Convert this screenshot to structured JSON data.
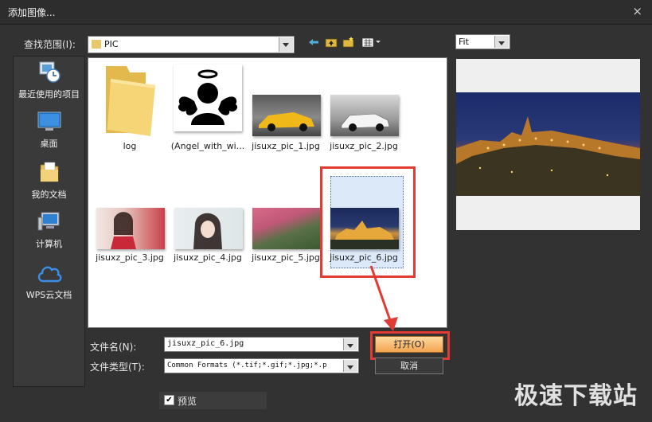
{
  "window": {
    "title": "添加图像...",
    "close_glyph": "×"
  },
  "lookin": {
    "label": "查找范围(I):",
    "value": "PIC"
  },
  "places": [
    {
      "label": "最近使用的项目",
      "icon": "recent-icon"
    },
    {
      "label": "桌面",
      "icon": "desktop-icon"
    },
    {
      "label": "我的文档",
      "icon": "documents-icon"
    },
    {
      "label": "计算机",
      "icon": "computer-icon"
    },
    {
      "label": "WPS云文档",
      "icon": "cloud-icon"
    }
  ],
  "files": [
    {
      "name": "log",
      "type": "folder"
    },
    {
      "name": "(Angel_with_wi...",
      "type": "image"
    },
    {
      "name": "jisuxz_pic_1.jpg",
      "type": "image"
    },
    {
      "name": "jisuxz_pic_2.jpg",
      "type": "image"
    },
    {
      "name": "jisuxz_pic_3.jpg",
      "type": "image"
    },
    {
      "name": "jisuxz_pic_4.jpg",
      "type": "image"
    },
    {
      "name": "jisuxz_pic_5.jpg",
      "type": "image"
    },
    {
      "name": "jisuxz_pic_6.jpg",
      "type": "image",
      "selected": true
    }
  ],
  "filename": {
    "label": "文件名(N):",
    "value": "jisuxz_pic_6.jpg"
  },
  "filetype": {
    "label": "文件类型(T):",
    "value": "Common Formats (*.tif;*.gif;*.jpg;*.p"
  },
  "buttons": {
    "open": "打开(O)",
    "cancel": "取消"
  },
  "preview": {
    "checkbox_label": "预览",
    "checked": true,
    "fit_value": "Fit"
  },
  "watermark": "极速下载站",
  "colors": {
    "highlight": "#e23b34",
    "open_button": "#f0a050"
  }
}
